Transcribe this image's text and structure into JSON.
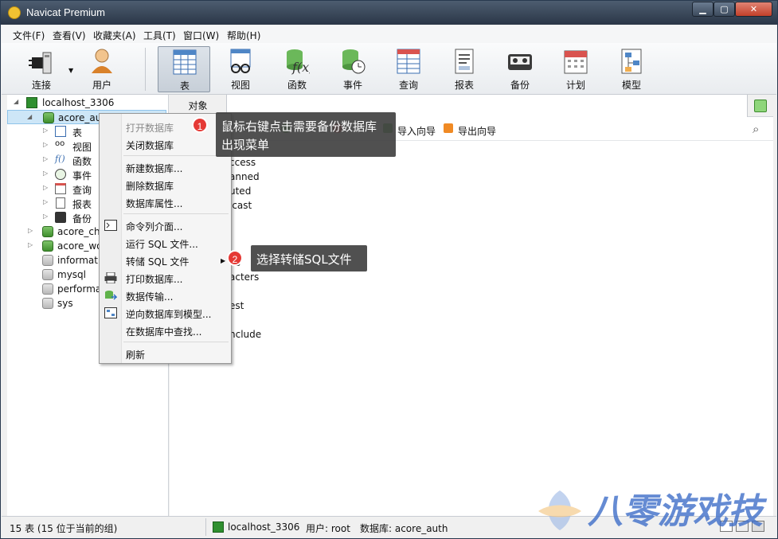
{
  "window": {
    "title": "Navicat Premium",
    "min_label": "▁",
    "max_label": "▢",
    "close_label": "✕"
  },
  "menu": [
    {
      "label": "文件(F)"
    },
    {
      "label": "查看(V)"
    },
    {
      "label": "收藏夹(A)"
    },
    {
      "label": "工具(T)"
    },
    {
      "label": "窗口(W)"
    },
    {
      "label": "帮助(H)"
    }
  ],
  "toolbar": [
    {
      "label": "连接",
      "icon": "plug-icon"
    },
    {
      "label": "用户",
      "icon": "user-icon"
    },
    {
      "label": "表",
      "icon": "table-icon"
    },
    {
      "label": "视图",
      "icon": "view-glasses-icon"
    },
    {
      "label": "函数",
      "icon": "function-icon"
    },
    {
      "label": "事件",
      "icon": "event-clock-icon"
    },
    {
      "label": "查询",
      "icon": "query-icon"
    },
    {
      "label": "报表",
      "icon": "report-icon"
    },
    {
      "label": "备份",
      "icon": "backup-tape-icon"
    },
    {
      "label": "计划",
      "icon": "calendar-icon"
    },
    {
      "label": "模型",
      "icon": "model-icon"
    }
  ],
  "tree": {
    "connection": "localhost_3306",
    "selected_db": "acore_auth",
    "children": [
      {
        "label": "表"
      },
      {
        "label": "视图"
      },
      {
        "label": "函数"
      },
      {
        "label": "事件"
      },
      {
        "label": "查询"
      },
      {
        "label": "报表"
      },
      {
        "label": "备份"
      }
    ],
    "databases": [
      {
        "label": "acore_ch"
      },
      {
        "label": "acore_wo"
      },
      {
        "label": "informati"
      },
      {
        "label": "mysql"
      },
      {
        "label": "performa"
      },
      {
        "label": "sys"
      }
    ]
  },
  "main": {
    "tab_label": "对象",
    "toolbar_labels": [
      "导入向导",
      "导出向导"
    ],
    "objects_partial": [
      "ccess",
      "anned",
      "uted",
      "lcast",
      "ns",
      "acters",
      "est",
      "nclude"
    ]
  },
  "context_menu": {
    "items": [
      {
        "label": "打开数据库",
        "disabled": true
      },
      {
        "label": "关闭数据库"
      },
      {
        "label": "新建数据库..."
      },
      {
        "label": "删除数据库"
      },
      {
        "label": "数据库属性..."
      },
      {
        "label": "命令列介面..."
      },
      {
        "label": "运行 SQL 文件..."
      },
      {
        "label": "转储 SQL 文件",
        "submenu": true
      },
      {
        "label": "打印数据库..."
      },
      {
        "label": "数据传输..."
      },
      {
        "label": "逆向数据库到模型..."
      },
      {
        "label": "在数据库中查找..."
      },
      {
        "label": "刷新"
      }
    ]
  },
  "annotations": [
    {
      "number": "1",
      "text_line1": "鼠标右键点击需要备份数据库",
      "text_line2": "出现菜单"
    },
    {
      "number": "2",
      "text_line1": "选择转储SQL文件"
    }
  ],
  "status": {
    "left": "15 表 (15 位于当前的组)",
    "connection": "localhost_3306",
    "user": "用户: root",
    "database": "数据库: acore_auth"
  },
  "watermark": "八零游戏技术"
}
